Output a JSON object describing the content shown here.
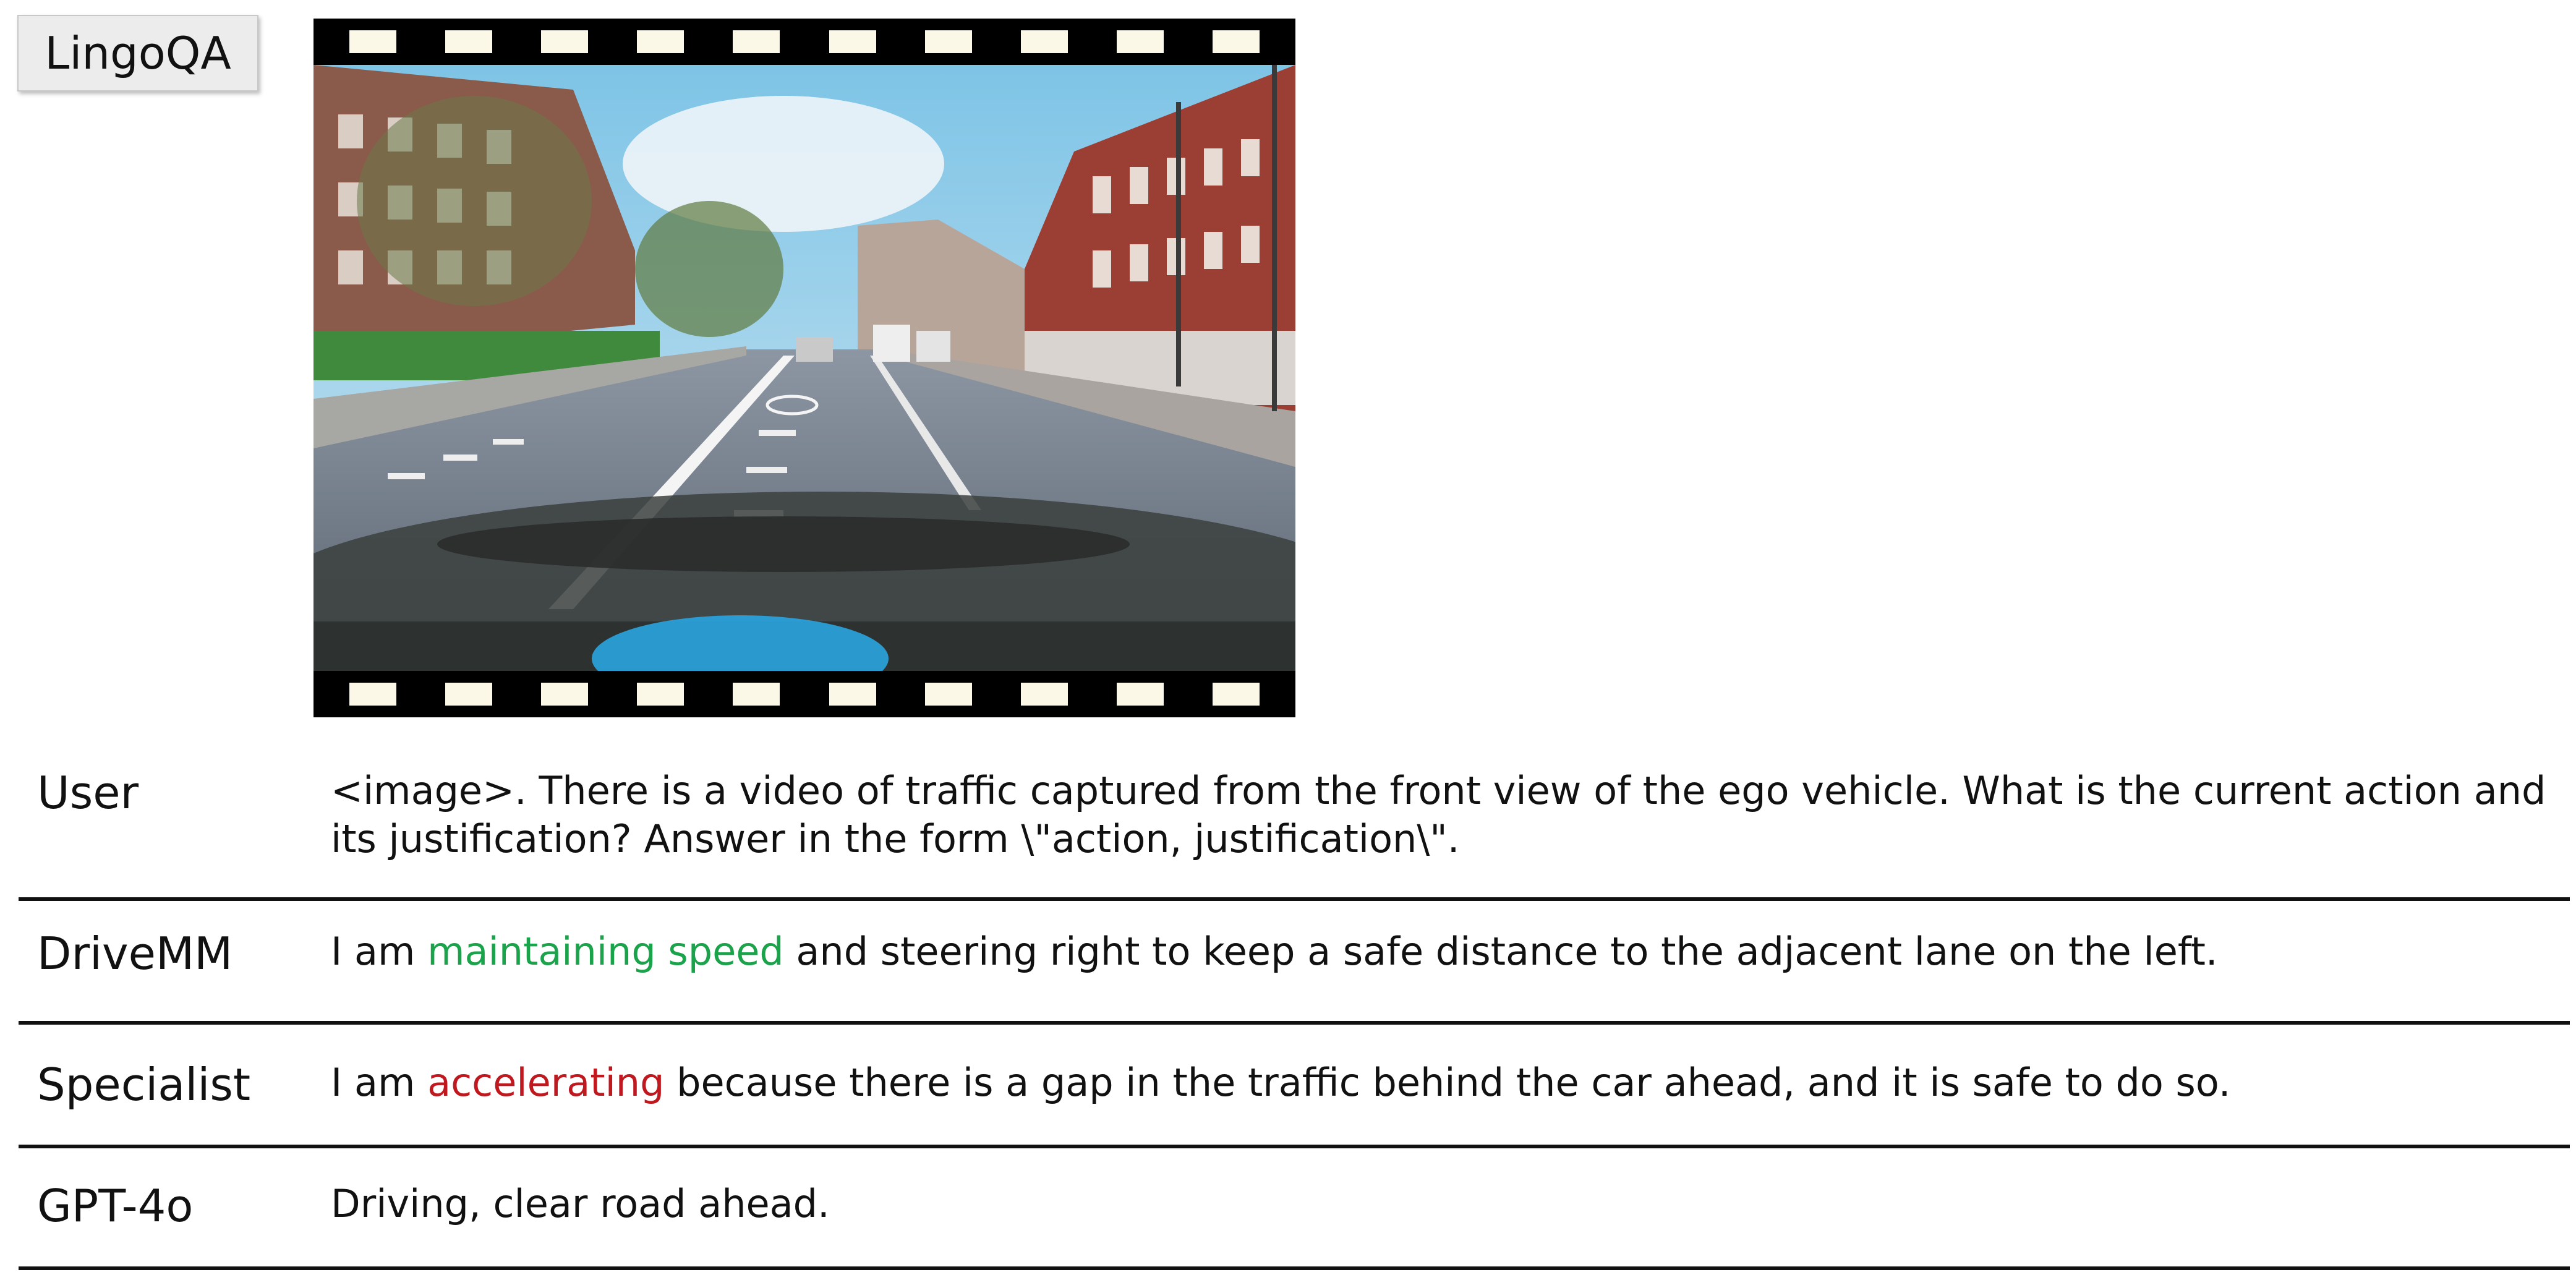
{
  "dataset_tag": "LingoQA",
  "rows": [
    {
      "speaker": "User",
      "text": "<image>. There is a video of traffic captured from the front view of the ego vehicle. What is the current action and its justification? Answer in the form \\\"action, justification\\\"."
    },
    {
      "speaker": "DriveMM",
      "pre": "I am ",
      "highlight": "maintaining speed",
      "post": " and steering right to keep a safe distance to the adjacent lane on the left.",
      "highlight_color": "#1aa34a"
    },
    {
      "speaker": "Specialist",
      "pre": "I am ",
      "highlight": "accelerating",
      "post": " because there is a gap in the traffic behind the car ahead, and it is safe to do so.",
      "highlight_color": "#c0181f"
    },
    {
      "speaker": "GPT-4o",
      "text": "Driving, clear road ahead."
    }
  ]
}
